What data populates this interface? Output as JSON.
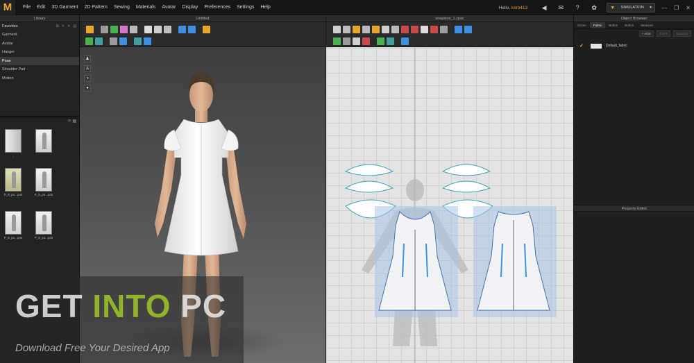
{
  "app": {
    "logo_letter": "M"
  },
  "menu": [
    "File",
    "Edit",
    "3D Garment",
    "2D Pattern",
    "Sewing",
    "Materials",
    "Avatar",
    "Display",
    "Preferences",
    "Settings",
    "Help"
  ],
  "header": {
    "greeting_prefix": "Hello,",
    "username": "ksro413",
    "simulation_label": "SIMULATION"
  },
  "library": {
    "title": "Library",
    "header": "Favorites",
    "items": [
      "Garment",
      "Avatar",
      "Hanger",
      "Pose",
      "Shoulder Pad",
      "Motion"
    ],
    "active_item": "Pose",
    "thumbnails": [
      "..",
      "P_8_po...pos",
      "P_8_po...pos",
      "P_8_po...pos",
      "P_8_po...pos",
      "P_8_po...pos"
    ]
  },
  "view3d": {
    "title": "Untitled"
  },
  "view2d": {
    "title": "onepiece_1.zpac"
  },
  "object_browser": {
    "title": "Object Browser",
    "tabs": [
      "Scene",
      "Fabric",
      "Button",
      "Button",
      "Measure"
    ],
    "active_tab": "Fabric",
    "actions": [
      "+ ADD",
      "COPY",
      "DELETE"
    ],
    "fabric_name": "Default_fabric"
  },
  "property_editor": {
    "title": "Property Editor"
  },
  "watermark": {
    "part1": "GET ",
    "part2": "INTO",
    "part3": " PC",
    "tagline": "Download Free Your Desired App"
  },
  "colors": {
    "accent": "#e6a72b",
    "watermark_green": "#a0c828",
    "pattern_blue": "#a9c4e8"
  }
}
